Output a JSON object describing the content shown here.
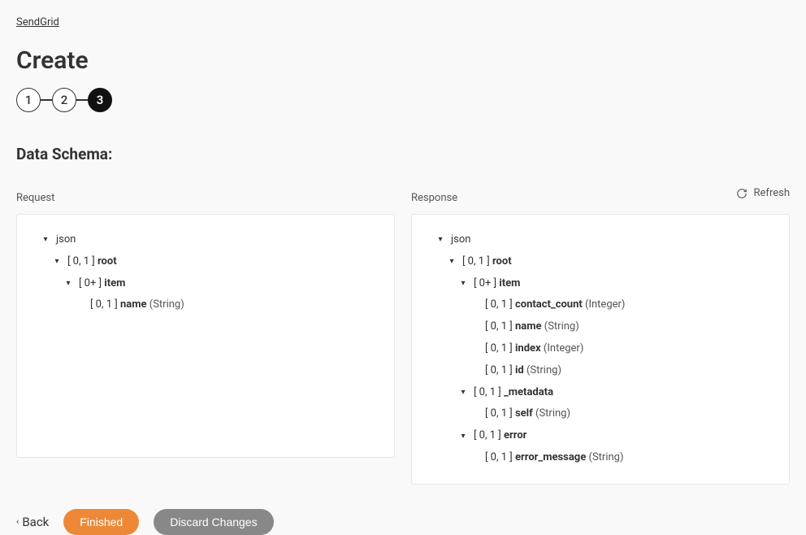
{
  "breadcrumb": {
    "parent": "SendGrid"
  },
  "page": {
    "title": "Create"
  },
  "stepper": {
    "steps": [
      "1",
      "2",
      "3"
    ],
    "activeIndex": 2
  },
  "section": {
    "title": "Data Schema:"
  },
  "refresh": {
    "label": "Refresh"
  },
  "request": {
    "label": "Request",
    "tree": {
      "json": "json",
      "root_card": "[ 0, 1 ]",
      "root_name": "root",
      "item_card": "[ 0+ ]",
      "item_name": "item",
      "name_card": "[ 0, 1 ]",
      "name_field": "name",
      "name_type": "(String)"
    }
  },
  "response": {
    "label": "Response",
    "tree": {
      "json": "json",
      "root_card": "[ 0, 1 ]",
      "root_name": "root",
      "item_card": "[ 0+ ]",
      "item_name": "item",
      "contact_count_card": "[ 0, 1 ]",
      "contact_count_field": "contact_count",
      "contact_count_type": "(Integer)",
      "name_card": "[ 0, 1 ]",
      "name_field": "name",
      "name_type": "(String)",
      "index_card": "[ 0, 1 ]",
      "index_field": "index",
      "index_type": "(Integer)",
      "id_card": "[ 0, 1 ]",
      "id_field": "id",
      "id_type": "(String)",
      "metadata_card": "[ 0, 1 ]",
      "metadata_field": "_metadata",
      "self_card": "[ 0, 1 ]",
      "self_field": "self",
      "self_type": "(String)",
      "error_card": "[ 0, 1 ]",
      "error_field": "error",
      "error_message_card": "[ 0, 1 ]",
      "error_message_field": "error_message",
      "error_message_type": "(String)"
    }
  },
  "footer": {
    "back": "Back",
    "finished": "Finished",
    "discard": "Discard Changes"
  }
}
